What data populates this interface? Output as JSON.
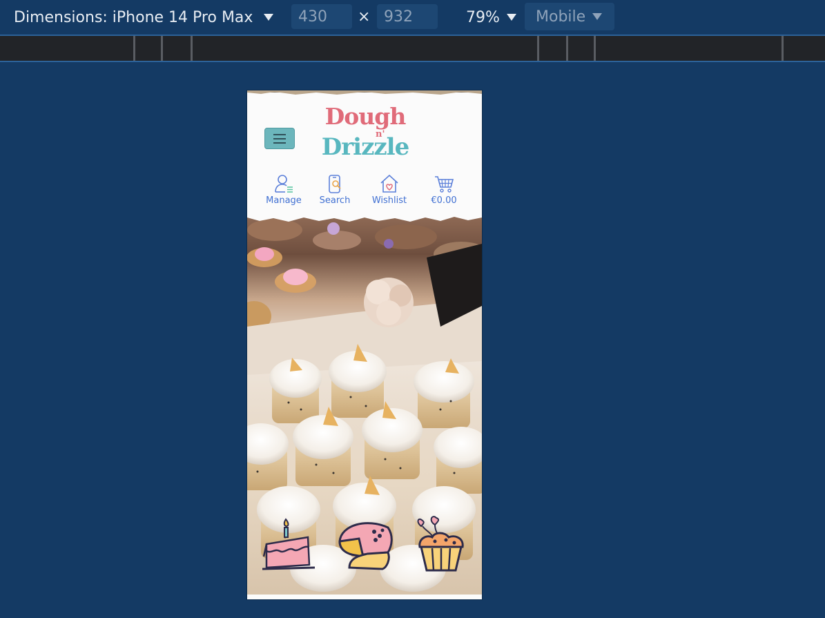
{
  "devtools": {
    "dimensions_label": "Dimensions: iPhone 14 Pro Max",
    "width_value": "430",
    "times": "×",
    "height_value": "932",
    "zoom": "79%",
    "mode": "Mobile"
  },
  "site": {
    "logo": {
      "line1": "Dough",
      "line2": "n'",
      "line3": "Drizzle"
    },
    "nav": [
      {
        "label": "Manage",
        "icon": "user-manage-icon"
      },
      {
        "label": "Search",
        "icon": "phone-search-icon"
      },
      {
        "label": "Wishlist",
        "icon": "house-heart-icon"
      },
      {
        "label": "€0.00",
        "icon": "cart-icon"
      }
    ],
    "hero": {
      "category_icons": [
        "birthday-cake-icon",
        "cheesecake-icon",
        "cupcake-icon"
      ]
    }
  },
  "colors": {
    "devtools_bg": "#143a64",
    "logo_pink": "#e06b79",
    "logo_teal": "#58b7bf",
    "nav_blue": "#3f6fd2",
    "menu_button": "#6cb6bc"
  }
}
